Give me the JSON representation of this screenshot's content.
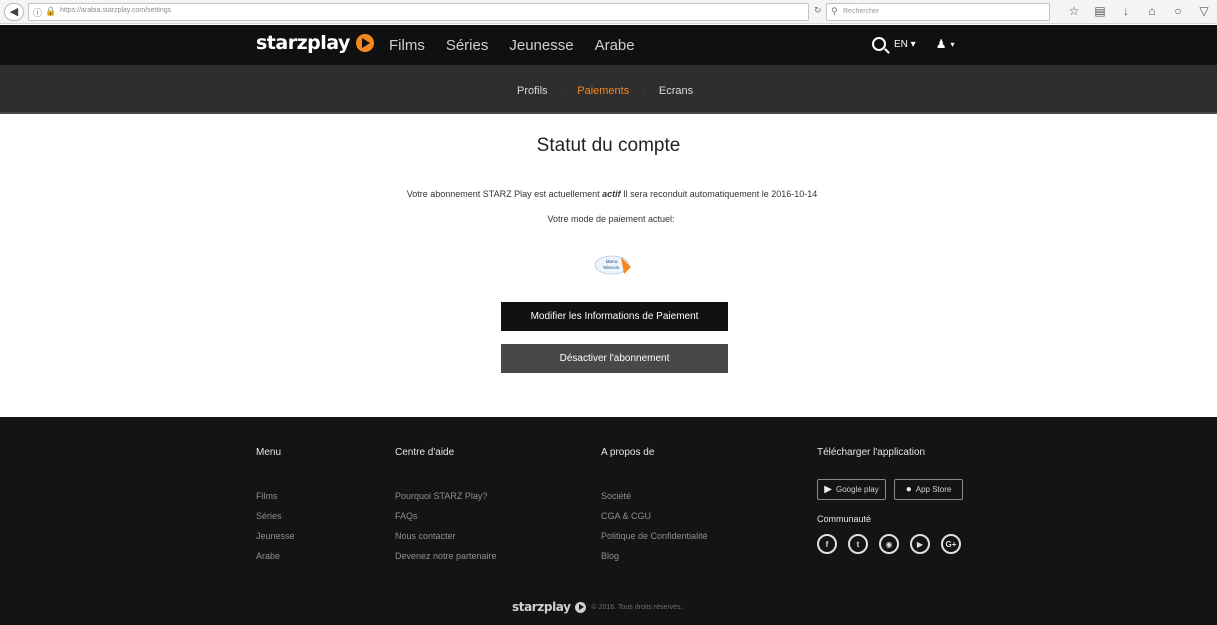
{
  "browser": {
    "url": "https://arabia.starzplay.com/settings",
    "search_placeholder": "Rechercher"
  },
  "header": {
    "logo_text": "starzplay",
    "nav": [
      "Films",
      "Séries",
      "Jeunesse",
      "Arabe"
    ],
    "language": "EN"
  },
  "subnav": {
    "items": [
      {
        "label": "Profils",
        "active": false
      },
      {
        "label": "Paiements",
        "active": true
      },
      {
        "label": "Ecrans",
        "active": false
      }
    ]
  },
  "main": {
    "title": "Statut du compte",
    "status_prefix": "Votre abonnement STARZ Play est actuellement",
    "status_value": "actif",
    "status_suffix": "Il sera reconduit automatiquement le 2016-10-14",
    "payment_label": "Votre mode de paiement actuel:",
    "provider_logo_line1": "Maroc",
    "provider_logo_line2": "Telecom",
    "modify_button": "Modifier les Informations de Paiement",
    "deactivate_button": "Désactiver l'abonnement"
  },
  "footer": {
    "menu": {
      "title": "Menu",
      "items": [
        "Films",
        "Séries",
        "Jeunesse",
        "Arabe"
      ]
    },
    "help": {
      "title": "Centre d'aide",
      "items": [
        "Pourquoi STARZ Play?",
        "FAQs",
        "Nous contacter",
        "Devenez notre partenaire"
      ]
    },
    "about": {
      "title": "A propos de",
      "items": [
        "Société",
        "CGA & CGU",
        "Politique de Confidentialité",
        "Blog"
      ]
    },
    "app": {
      "title": "Télécharger l'application",
      "google_play": "Google play",
      "app_store": "App Store",
      "community": "Communauté"
    },
    "logo_text": "starzplay",
    "copyright": "© 2016. Tous droits réservés."
  },
  "colors": {
    "accent": "#f5871f",
    "header_bg": "#101010",
    "subnav_bg": "#2e2e2e",
    "footer_bg": "#141414"
  }
}
